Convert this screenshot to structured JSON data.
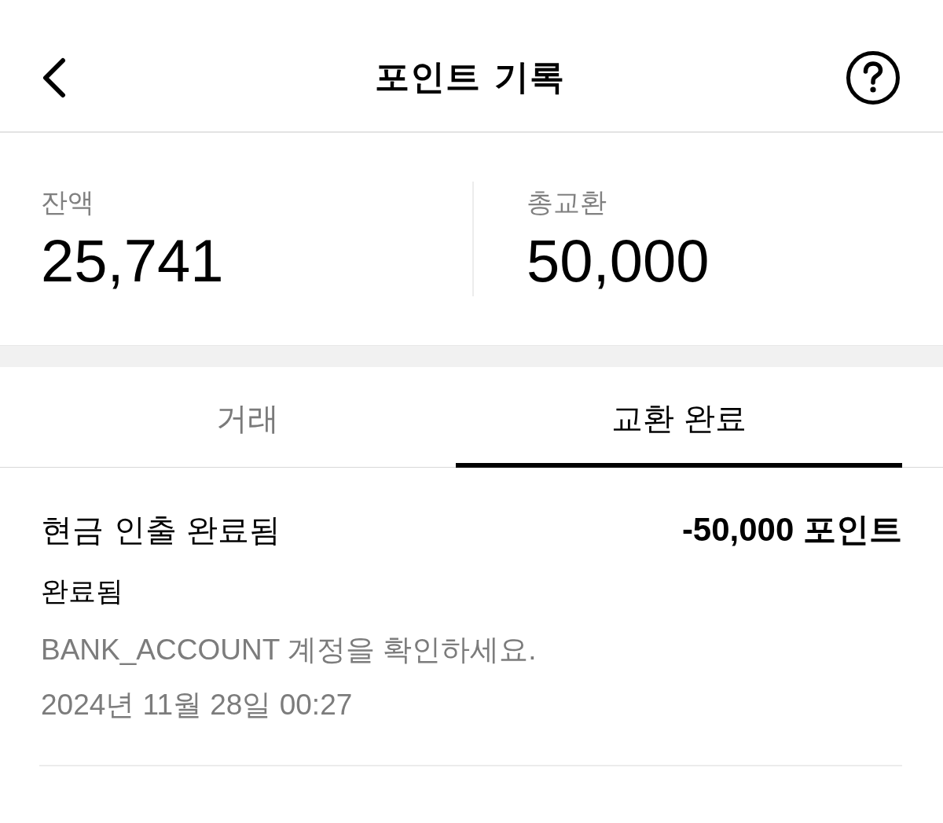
{
  "header": {
    "title": "포인트 기록"
  },
  "summary": [
    {
      "label": "잔액",
      "value": "25,741"
    },
    {
      "label": "총교환",
      "value": "50,000"
    }
  ],
  "tabs": [
    {
      "label": "거래",
      "selected": false
    },
    {
      "label": "교환 완료",
      "selected": true
    }
  ],
  "transactions": [
    {
      "title": "현금 인출 완료됨",
      "amount": "-50,000 포인트",
      "status": "완료됨",
      "note": "BANK_ACCOUNT 계정을 확인하세요.",
      "date": "2024년 11월 28일 00:27"
    }
  ]
}
